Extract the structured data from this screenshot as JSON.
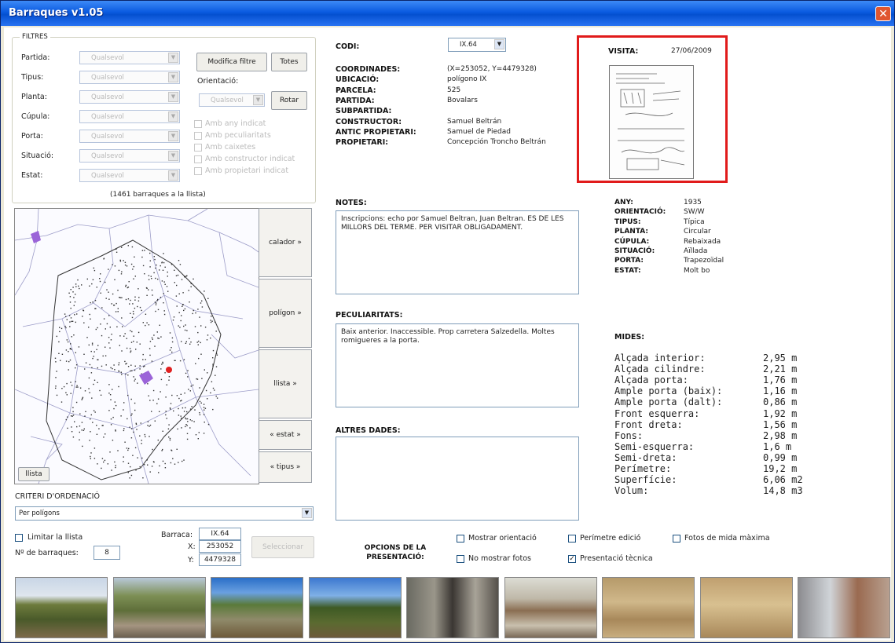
{
  "window": {
    "title": "Barraques v1.05",
    "close_label": "✕"
  },
  "filters": {
    "group_title": "FILTRES",
    "fields": [
      {
        "label": "Partida:",
        "value": "Qualsevol"
      },
      {
        "label": "Tipus:",
        "value": "Qualsevol"
      },
      {
        "label": "Planta:",
        "value": "Qualsevol"
      },
      {
        "label": "Cúpula:",
        "value": "Qualsevol"
      },
      {
        "label": "Porta:",
        "value": "Qualsevol"
      },
      {
        "label": "Situació:",
        "value": "Qualsevol"
      },
      {
        "label": "Estat:",
        "value": "Qualsevol"
      }
    ],
    "modifica_label": "Modifica filtre",
    "totes_label": "Totes",
    "orientacio_label": "Orientació:",
    "orientacio_value": "Qualsevol",
    "rotar_label": "Rotar",
    "checks": [
      "Amb any indicat",
      "Amb peculiaritats",
      "Amb caixetes",
      "Amb constructor indicat",
      "Amb propietari indicat"
    ],
    "count_text": "(1461 barraques a la llista)"
  },
  "map_buttons": [
    "calador »",
    "polígon »",
    "llista »",
    "« estat »",
    "« tipus »"
  ],
  "llista_button": "llista",
  "sort": {
    "title": "CRITERI D'ORDENACIÓ",
    "value": "Per polígons"
  },
  "limit": {
    "check_label": "Limitar la llista",
    "count_label": "Nº de barraques:",
    "count_value": "8"
  },
  "barraca": {
    "label": "Barraca:",
    "value": "IX.64",
    "x_label": "X:",
    "x_value": "253052",
    "y_label": "Y:",
    "y_value": "4479328",
    "select_label": "Seleccionar"
  },
  "info": {
    "code_label": "CODI:",
    "code_value": "IX.64",
    "rows": [
      {
        "label": "COORDINADES:",
        "value": "(X=253052, Y=4479328)"
      },
      {
        "label": "UBICACIÓ:",
        "value": "polígono IX"
      },
      {
        "label": "PARCELA:",
        "value": "525"
      },
      {
        "label": "PARTIDA:",
        "value": "Bovalars"
      },
      {
        "label": "SUBPARTIDA:",
        "value": ""
      },
      {
        "label": "CONSTRUCTOR:",
        "value": "Samuel Beltrán"
      },
      {
        "label": "ANTIC PROPIETARI:",
        "value": "Samuel de Piedad"
      },
      {
        "label": "PROPIETARI:",
        "value": "Concepción Troncho Beltrán"
      }
    ]
  },
  "visita": {
    "label": "VISITA:",
    "date": "27/06/2009"
  },
  "notes": {
    "label": "NOTES:",
    "text": "Inscripcions: echo por Samuel Beltran, Juan Beltran. ES DE LES MILLORS DEL TERME. PER VISITAR OBLIGADAMENT."
  },
  "peculiaritats": {
    "label": "PECULIARITATS:",
    "text": "Baix anterior. Inaccessible. Prop carretera Salzedella. Moltes romigueres a la porta."
  },
  "altres": {
    "label": "ALTRES DADES:",
    "text": ""
  },
  "attrs": [
    {
      "label": "ANY:",
      "value": "1935"
    },
    {
      "label": "ORIENTACIÓ:",
      "value": "SW/W"
    },
    {
      "label": "TIPUS:",
      "value": "Típica"
    },
    {
      "label": "PLANTA:",
      "value": "Circular"
    },
    {
      "label": "CÚPULA:",
      "value": "Rebaixada"
    },
    {
      "label": "SITUACIÓ:",
      "value": "Aïllada"
    },
    {
      "label": "PORTA:",
      "value": "Trapezoïdal"
    },
    {
      "label": "ESTAT:",
      "value": "Molt bo"
    }
  ],
  "mides": {
    "title": "MIDES:",
    "rows": [
      {
        "label": "Alçada interior:",
        "value": "2,95 m"
      },
      {
        "label": "Alçada cilindre:",
        "value": "2,21 m"
      },
      {
        "label": "Alçada porta:",
        "value": "1,76 m"
      },
      {
        "label": "Ample porta (baix):",
        "value": "1,16 m"
      },
      {
        "label": "Ample porta (dalt):",
        "value": "0,86 m"
      },
      {
        "label": "Front esquerra:",
        "value": "1,92 m"
      },
      {
        "label": "Front dreta:",
        "value": "1,56 m"
      },
      {
        "label": "Fons:",
        "value": "2,98 m"
      },
      {
        "label": "Semi-esquerra:",
        "value": "1,6 m"
      },
      {
        "label": "Semi-dreta:",
        "value": "0,99 m"
      },
      {
        "label": "Perímetre:",
        "value": "19,2 m"
      },
      {
        "label": "Superfície:",
        "value": "6,06 m2"
      },
      {
        "label": "Volum:",
        "value": "14,8 m3"
      }
    ]
  },
  "options": {
    "title_line1": "OPCIONS DE LA",
    "title_line2": "PRESENTACIÓ:",
    "checks": [
      {
        "label": "Mostrar orientació",
        "checked": false
      },
      {
        "label": "Perímetre edició",
        "checked": false
      },
      {
        "label": "Fotos de mida màxima",
        "checked": false
      },
      {
        "label": "No mostrar fotos",
        "checked": false
      },
      {
        "label": "Presentació tècnica",
        "checked": true
      }
    ]
  },
  "colors": {
    "title_bar": "#0a5ae0",
    "highlight_border": "#e11b1b",
    "map_purple": "#9b64d8",
    "marker_red": "#e02020"
  }
}
